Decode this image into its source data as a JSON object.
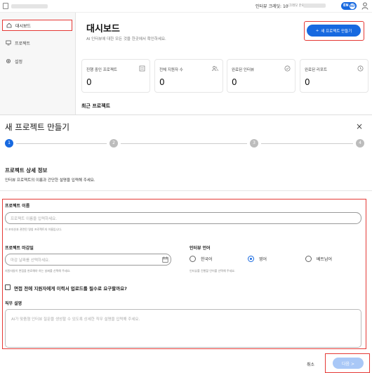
{
  "header": {
    "credit_label": "인터뷰 크레딧: 10",
    "credit_sub": "(크레딧 만료일:",
    "lang_en": "EN",
    "lang_ko": "KO"
  },
  "sidebar": {
    "items": [
      {
        "label": "대시보드",
        "icon": "home-icon"
      },
      {
        "label": "프로젝트",
        "icon": "monitor-icon"
      },
      {
        "label": "설정",
        "icon": "gear-icon"
      }
    ]
  },
  "dashboard": {
    "title": "대시보드",
    "subtitle": "AI 인터뷰에 대한 모든 것을 한곳에서 확인하세요.",
    "new_project_label": "새 프로젝트 만들기",
    "stats": [
      {
        "label": "진행 중인 프로젝트",
        "value": "0",
        "icon": "clipboard-icon"
      },
      {
        "label": "전체 지원자 수",
        "value": "0",
        "icon": "users-icon"
      },
      {
        "label": "완료된 인터뷰",
        "value": "0",
        "icon": "check-circle-icon"
      },
      {
        "label": "완료된 리포트",
        "value": "0",
        "icon": "clock-icon"
      }
    ],
    "recent_projects": "최근 프로젝트"
  },
  "modal": {
    "title": "새 프로젝트 만들기",
    "close": "×",
    "steps": [
      "1",
      "2",
      "3",
      "4"
    ],
    "current_step": 1,
    "section_title": "프로젝트 상세 정보",
    "section_subtitle": "인터뷰 프로젝트의 이름과 간단한 설명을 입력해 주세요.",
    "project_name_label": "프로젝트 이름",
    "project_name_placeholder": "프로젝트 이름을 입력하세요.",
    "project_name_hint": "이 포지션과 관련된 명칭 프로젝트의 이름입니다.",
    "deadline_label": "프로젝트 마감일",
    "deadline_placeholder": "마감 날짜를 선택하세요.",
    "deadline_hint": "지원자들이 면접을 완료해야 하는 날짜를 선택해 주세요.",
    "language_label": "인터뷰 언어",
    "language_options": [
      "한국어",
      "영어",
      "베트남어"
    ],
    "language_selected": "영어",
    "language_hint": "인터뷰를 진행할 언어를 선택해 주세요.",
    "resume_checkbox_label": "면접 전에 지원자에게 이력서 업로드를 필수로 요구할까요?",
    "job_desc_label": "직무 설명",
    "job_desc_placeholder": "AI가 맞춤형 인터뷰 질문을 생성할 수 있도록 상세한 직무 설명을 입력해 주세요.",
    "cancel_label": "취소",
    "next_label": "다음 >"
  },
  "colors": {
    "accent": "#1769e0",
    "highlight": "#e53935",
    "next_disabled": "#a9c8f7"
  }
}
